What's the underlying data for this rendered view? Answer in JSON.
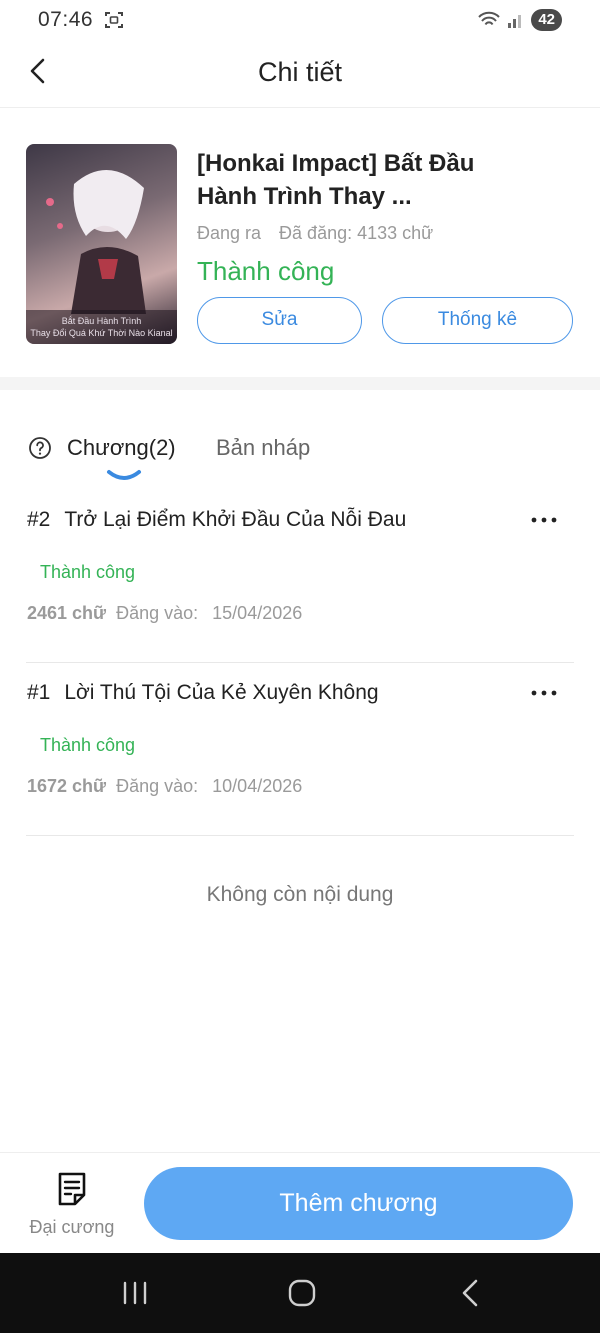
{
  "status_bar": {
    "time": "07:46",
    "battery": "42"
  },
  "header": {
    "title": "Chi tiết"
  },
  "book": {
    "title": "[Honkai Impact] Bất Đầu Hành Trình Thay ...",
    "state": "Đang ra",
    "word_count": "Đã đăng: 4133 chữ",
    "status": "Thành công",
    "cover_caption_line1": "Bắt Đầu Hành Trình",
    "cover_caption_line2": "Thay Đổi Quá Khứ Thời Nào Kianal",
    "edit_label": "Sửa",
    "stats_label": "Thống kê"
  },
  "tabs": {
    "chapters": "Chương(2)",
    "drafts": "Bản nháp"
  },
  "chapters": [
    {
      "num": "#2",
      "title": "Trở Lại Điểm Khởi Đầu Của Nỗi Đau",
      "status": "Thành công",
      "words": "2461 chữ",
      "posted_label": "Đăng vào:",
      "date": "15/04/2026"
    },
    {
      "num": "#1",
      "title": "Lời Thú Tội Của Kẻ Xuyên Không",
      "status": "Thành công",
      "words": "1672 chữ",
      "posted_label": "Đăng vào:",
      "date": "10/04/2026"
    }
  ],
  "empty_message": "Không còn nội dung",
  "bottom": {
    "outline_label": "Đại cương",
    "add_chapter_label": "Thêm chương"
  },
  "colors": {
    "success": "#34b356",
    "accent": "#5ea8f3",
    "outline_button": "#4f98e8"
  },
  "icons": [
    "back-arrow-icon",
    "help-circle-icon",
    "more-dots-icon",
    "outline-document-icon",
    "recent-apps-icon",
    "home-icon",
    "system-back-icon"
  ]
}
